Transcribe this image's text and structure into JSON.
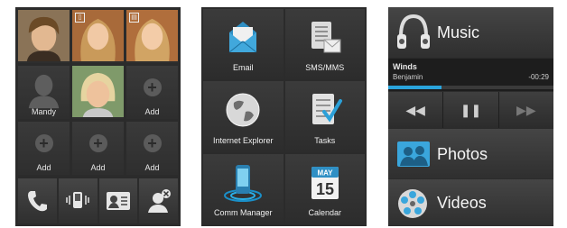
{
  "contacts_panel": {
    "tiles": [
      {
        "label": "",
        "photo": "young-man-photo"
      },
      {
        "label": "",
        "photo": "woman-photo"
      },
      {
        "label": "",
        "photo": "woman-photo"
      },
      {
        "label": "Mandy",
        "photo": "placeholder-silhouette"
      },
      {
        "label": "",
        "photo": "older-woman-photo"
      },
      {
        "label": "Add",
        "photo": "add-icon"
      },
      {
        "label": "Add",
        "photo": "add-icon"
      },
      {
        "label": "Add",
        "photo": "add-icon"
      },
      {
        "label": "Add",
        "photo": "add-icon"
      }
    ],
    "bottom_bar": [
      "phone-icon",
      "phone-vibrate-icon",
      "contact-card-icon",
      "remove-contact-icon"
    ]
  },
  "apps_panel": {
    "apps": [
      {
        "label": "Email",
        "icon": "email-icon"
      },
      {
        "label": "SMS/MMS",
        "icon": "sms-icon"
      },
      {
        "label": "Internet Explorer",
        "icon": "globe-icon"
      },
      {
        "label": "Tasks",
        "icon": "tasks-icon"
      },
      {
        "label": "Comm Manager",
        "icon": "comm-manager-icon"
      },
      {
        "label": "Calendar",
        "icon": "calendar-icon",
        "calendar_month": "MAY",
        "calendar_day": "15"
      }
    ]
  },
  "media_panel": {
    "music_label": "Music",
    "now_playing": {
      "title": "Winds",
      "artist": "Benjamin",
      "time": "-00:29",
      "progress": 0.32
    },
    "controls": [
      "rewind-icon",
      "pause-icon",
      "fast-forward-icon"
    ],
    "photos_label": "Photos",
    "videos_label": "Videos"
  }
}
